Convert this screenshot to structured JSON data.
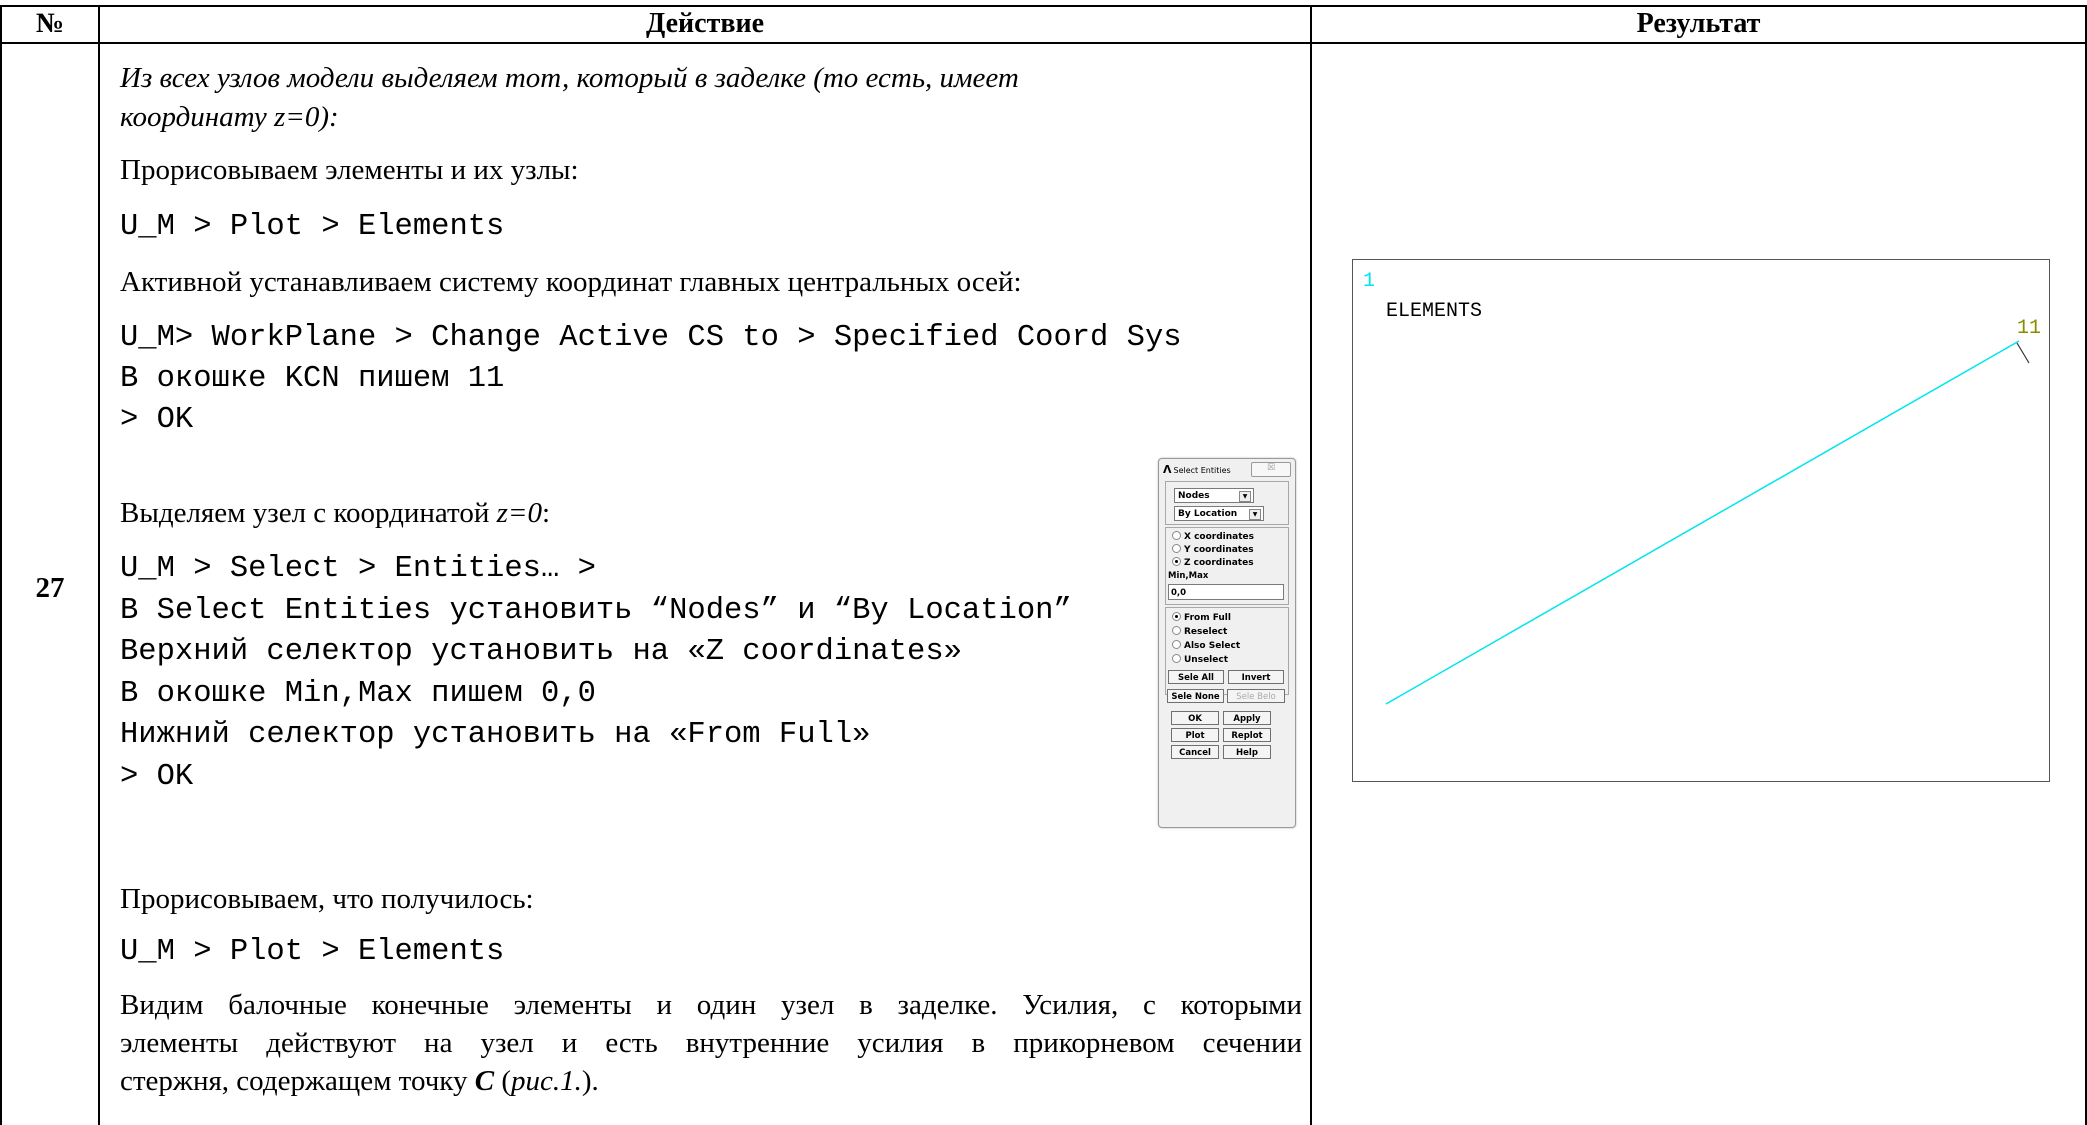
{
  "table": {
    "headers": {
      "num": "№",
      "action": "Действие",
      "result": "Результат"
    },
    "row_number": "27"
  },
  "action": {
    "intro_line1": "Из всех узлов модели выделяем тот, который в заделке (то есть, имеет",
    "intro_line2": "координату z=0):",
    "draw_label": "Прорисовываем элементы и их узлы:",
    "cmd_plot_elements": "U_M > Plot > Elements",
    "cs_label": "Активной устанавливаем систему координат  главных центральных осей:",
    "cs_cmd1": "U_M> WorkPlane > Change Active CS to > Specified Coord Sys",
    "cs_cmd2": "В окошке KCN пишем 11",
    "cs_cmd3": "> OK",
    "select_label_prefix": "Выделяем узел с координатой ",
    "select_label_var": "z=0",
    "select_label_suffix": ":",
    "sel_cmd1": "U_M > Select > Entities… >",
    "sel_cmd2": "В Select Entities установить “Nodes” и “By Location”",
    "sel_cmd3": "Верхний селектор установить на «Z coordinates»",
    "sel_cmd4": "В окошке Min,Max пишем 0,0",
    "sel_cmd5": "Нижний селектор установить на «From Full»",
    "sel_cmd6": "> OK",
    "result_label": "Прорисовываем, что получилось:",
    "cmd_plot_elements2": "U_M > Plot > Elements",
    "conclusion_line1": "Видим балочные конечные элементы и один узел в заделке. Усилия, с которыми",
    "conclusion_line2": "элементы действуют на узел и есть внутренние усилия в прикорневом сечении",
    "conclusion_line3_a": "стержня, содержащем точку ",
    "conclusion_line3_b": "C",
    "conclusion_line3_c": " (",
    "conclusion_line3_d": "рис.1.",
    "conclusion_line3_e": ")."
  },
  "dialog": {
    "title": "Select Entities",
    "close_label": "☒",
    "entity_select": "Nodes",
    "method_select": "By Location",
    "coord_options": [
      {
        "label": "X coordinates",
        "selected": false
      },
      {
        "label": "Y coordinates",
        "selected": false
      },
      {
        "label": "Z coordinates",
        "selected": true
      }
    ],
    "minmax_label": "Min,Max",
    "minmax_value": "0,0",
    "mode_options": [
      {
        "label": "From Full",
        "selected": true
      },
      {
        "label": "Reselect",
        "selected": false
      },
      {
        "label": "Also Select",
        "selected": false
      },
      {
        "label": "Unselect",
        "selected": false
      }
    ],
    "buttons": {
      "sele_all": "Sele All",
      "invert": "Invert",
      "sele_none": "Sele None",
      "sele_belo": "Sele Belo",
      "ok": "OK",
      "apply": "Apply",
      "plot": "Plot",
      "replot": "Replot",
      "cancel": "Cancel",
      "help": "Help"
    }
  },
  "graphics": {
    "window_number": "1",
    "label": "ELEMENTS",
    "node_label": "11",
    "line_color": "#00e5ee",
    "window_number_color": "#00e5ee",
    "node_label_color": "#8b8b00"
  }
}
